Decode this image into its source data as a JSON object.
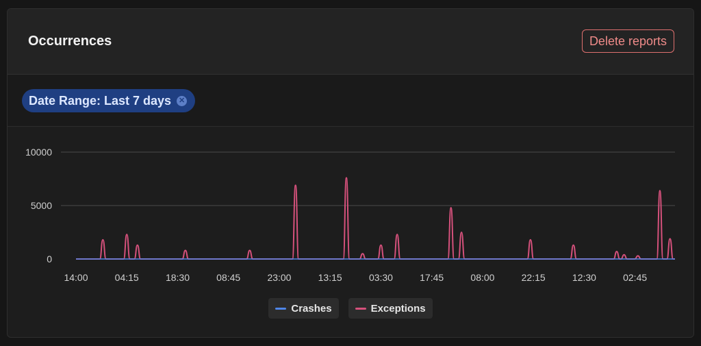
{
  "header": {
    "title": "Occurrences",
    "delete_label": "Delete reports"
  },
  "filter": {
    "chip_label": "Date Range: Last 7 days"
  },
  "colors": {
    "crashes": "#4f86e8",
    "exceptions": "#d6517c",
    "grid": "#4a4a4a"
  },
  "chart_data": {
    "type": "line",
    "title": "",
    "xlabel": "",
    "ylabel": "",
    "ylim": [
      0,
      10000
    ],
    "y_ticks": [
      "10000",
      "5000",
      "0"
    ],
    "y_tick_values": [
      10000,
      5000,
      0
    ],
    "x_tick_labels": [
      "14:00",
      "04:15",
      "18:30",
      "08:45",
      "23:00",
      "13:15",
      "03:30",
      "17:45",
      "08:00",
      "22:15",
      "12:30",
      "02:45"
    ],
    "x_tick_positions": [
      0,
      0.0848,
      0.1697,
      0.2545,
      0.3394,
      0.4242,
      0.5091,
      0.5939,
      0.6788,
      0.7636,
      0.8485,
      0.9333
    ],
    "grid": "horizontal",
    "legend_position": "bottom-center",
    "series": [
      {
        "name": "Crashes",
        "points": [
          [
            0,
            0
          ],
          [
            1,
            0
          ]
        ]
      },
      {
        "name": "Exceptions",
        "points": [
          [
            0.0449,
            1800
          ],
          [
            0.0848,
            2300
          ],
          [
            0.1026,
            1300
          ],
          [
            0.1826,
            800
          ],
          [
            0.29,
            800
          ],
          [
            0.3665,
            6900
          ],
          [
            0.4514,
            7600
          ],
          [
            0.4785,
            500
          ],
          [
            0.5091,
            1300
          ],
          [
            0.5362,
            2300
          ],
          [
            0.626,
            4800
          ],
          [
            0.6436,
            2500
          ],
          [
            0.7587,
            1800
          ],
          [
            0.8304,
            1300
          ],
          [
            0.9027,
            700
          ],
          [
            0.915,
            400
          ],
          [
            0.9381,
            300
          ],
          [
            0.9748,
            6400
          ],
          [
            0.9917,
            1900
          ]
        ]
      }
    ],
    "x_range": [
      0,
      1
    ]
  },
  "legend": {
    "crashes_label": "Crashes",
    "exceptions_label": "Exceptions"
  }
}
